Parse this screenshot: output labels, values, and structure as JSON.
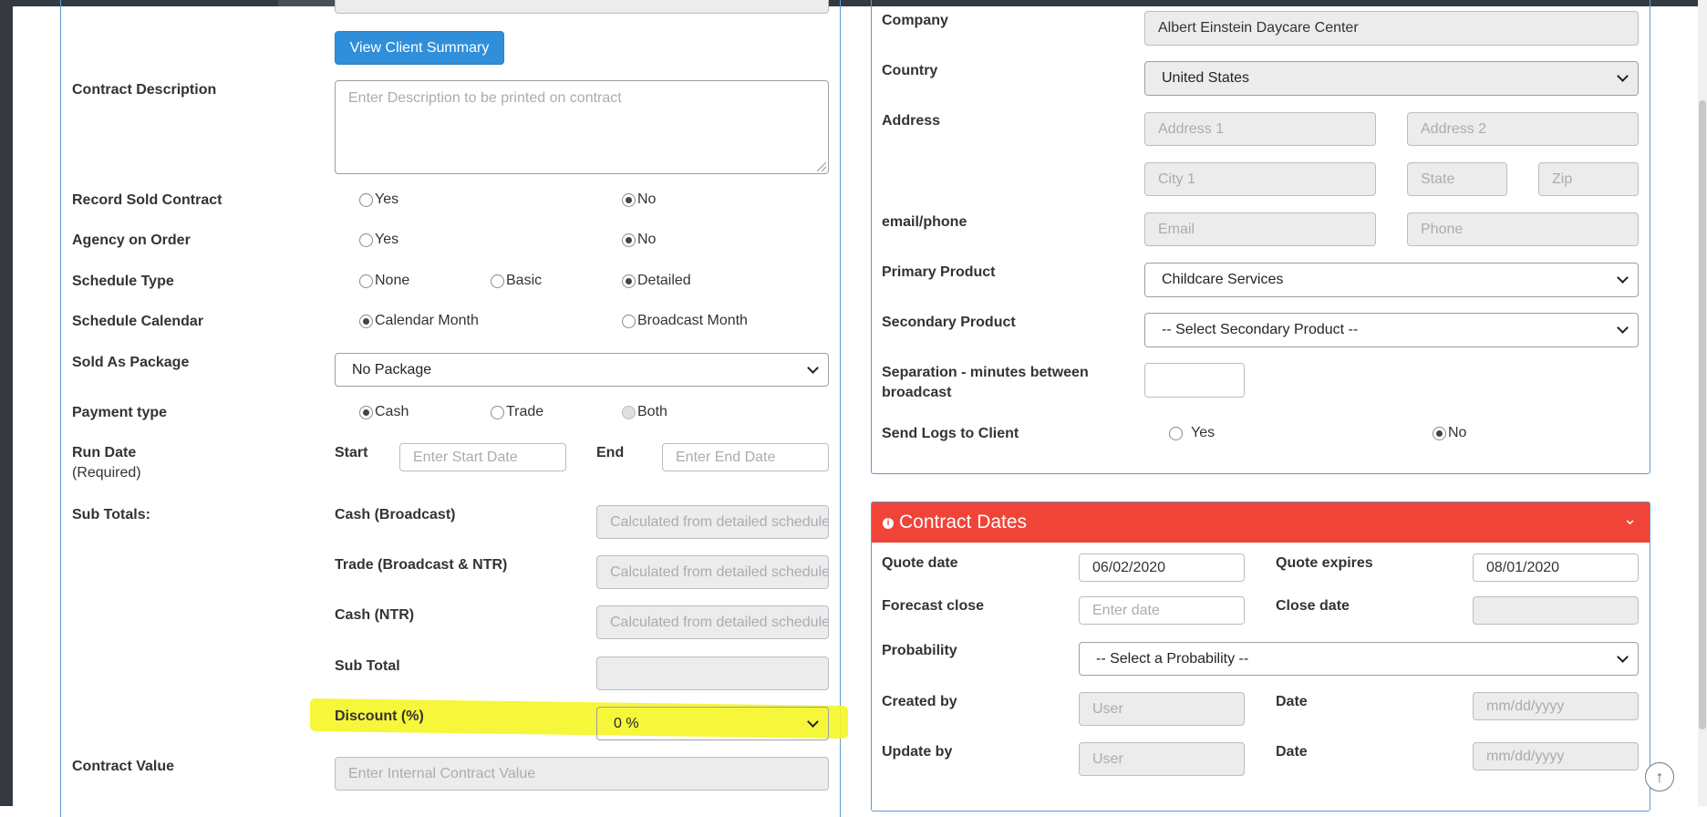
{
  "left": {
    "view_client_summary": "View Client Summary",
    "contract_description": {
      "label": "Contract Description",
      "placeholder": "Enter Description to be printed on contract"
    },
    "record_sold_contract": {
      "label": "Record Sold Contract",
      "yes": "Yes",
      "no": "No"
    },
    "agency_on_order": {
      "label": "Agency on Order",
      "yes": "Yes",
      "no": "No"
    },
    "schedule_type": {
      "label": "Schedule Type",
      "none": "None",
      "basic": "Basic",
      "detailed": "Detailed"
    },
    "schedule_calendar": {
      "label": "Schedule Calendar",
      "calendar_month": "Calendar Month",
      "broadcast_month": "Broadcast Month"
    },
    "sold_as_package": {
      "label": "Sold As Package",
      "value": "No Package"
    },
    "payment_type": {
      "label": "Payment type",
      "cash": "Cash",
      "trade": "Trade",
      "both": "Both"
    },
    "run_date": {
      "label": "Run Date",
      "required": "(Required)",
      "start_label": "Start",
      "start_placeholder": "Enter Start Date",
      "end_label": "End",
      "end_placeholder": "Enter End Date"
    },
    "sub_totals": {
      "label": "Sub Totals:",
      "cash_broadcast": "Cash (Broadcast)",
      "trade_broadcast_ntr": "Trade (Broadcast & NTR)",
      "cash_ntr": "Cash (NTR)",
      "calc_placeholder": "Calculated from detailed schedule",
      "sub_total": "Sub Total"
    },
    "discount": {
      "label": "Discount (%)",
      "value": "0 %"
    },
    "contract_value": {
      "label": "Contract Value",
      "placeholder": "Enter Internal Contract Value"
    }
  },
  "right": {
    "company": {
      "label": "Company",
      "value": "Albert Einstein Daycare Center"
    },
    "country": {
      "label": "Country",
      "value": "United States"
    },
    "address": {
      "label": "Address",
      "address1": "Address 1",
      "address2": "Address 2",
      "city": "City 1",
      "state": "State",
      "zip": "Zip"
    },
    "email_phone": {
      "label": "email/phone",
      "email": "Email",
      "phone": "Phone"
    },
    "primary_product": {
      "label": "Primary Product",
      "value": "Childcare Services"
    },
    "secondary_product": {
      "label": "Secondary Product",
      "value": "-- Select Secondary Product --"
    },
    "separation": {
      "label_line1": "Separation - minutes between",
      "label_line2": "broadcast"
    },
    "send_logs": {
      "label": "Send Logs to Client",
      "yes": "Yes",
      "no": "No"
    }
  },
  "contract_dates": {
    "title": "Contract Dates",
    "quote_date": {
      "label": "Quote date",
      "value": "06/02/2020"
    },
    "quote_expires": {
      "label": "Quote expires",
      "value": "08/01/2020"
    },
    "forecast_close": {
      "label": "Forecast close",
      "placeholder": "Enter date"
    },
    "close_date": {
      "label": "Close date"
    },
    "probability": {
      "label": "Probability",
      "value": "-- Select a Probability --"
    },
    "created_by": {
      "label": "Created by",
      "placeholder": "User",
      "date_label": "Date",
      "date_placeholder": "mm/dd/yyyy"
    },
    "update_by": {
      "label": "Update by",
      "placeholder": "User",
      "date_label": "Date",
      "date_placeholder": "mm/dd/yyyy"
    }
  },
  "colors": {
    "accent": "#2f8fdb",
    "header_red": "#f04438",
    "border_blue": "#5b9bd5",
    "highlight": "#f5f52a"
  },
  "icons": {
    "info": "info-icon",
    "collapse": "chevron-down-icon",
    "scroll_top": "arrow-up-circle-icon"
  }
}
